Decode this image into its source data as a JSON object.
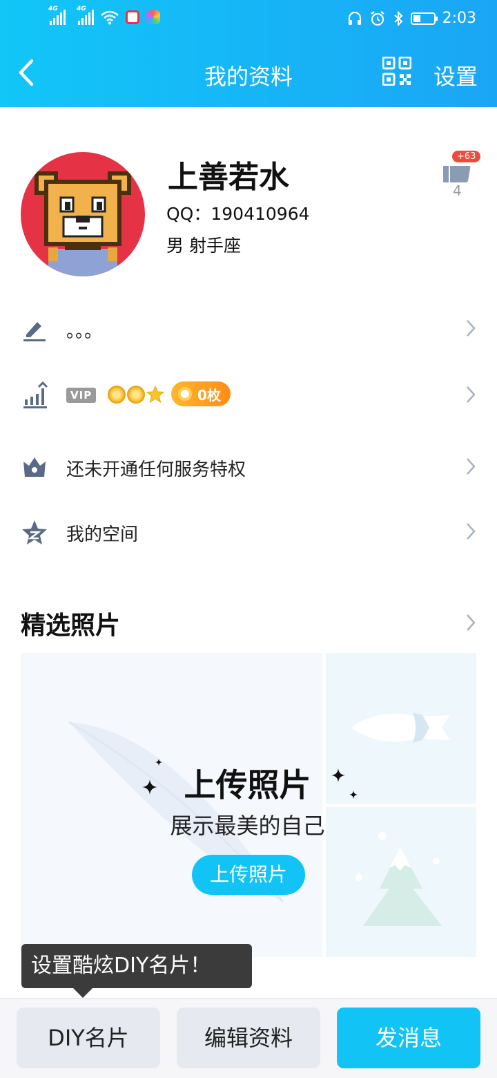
{
  "status_bar": {
    "time": "2:03",
    "network_tag": "4G"
  },
  "nav": {
    "title": "我的资料",
    "settings_label": "设置"
  },
  "profile": {
    "name": "上善若水",
    "qq": "QQ：190410964",
    "gender_zodiac": "男  射手座",
    "like_badge": "+63",
    "like_count": "4"
  },
  "rows": {
    "signature": "。。。",
    "vip_tag": "VIP",
    "coins": "0枚",
    "privilege": "还未开通任何服务特权",
    "space": "我的空间"
  },
  "photos": {
    "section_title": "精选照片",
    "upload_title": "上传照片",
    "upload_subtitle": "展示最美的自己",
    "upload_button": "上传照片"
  },
  "tooltip": "设置酷炫DIY名片！",
  "bottom": {
    "diy_label": "DIY名片",
    "edit_label": "编辑资料",
    "message_label": "发消息"
  },
  "colors": {
    "accent": "#12c3f6",
    "avatar_bg": "#e53245",
    "badge_red": "#ef4b3b"
  }
}
